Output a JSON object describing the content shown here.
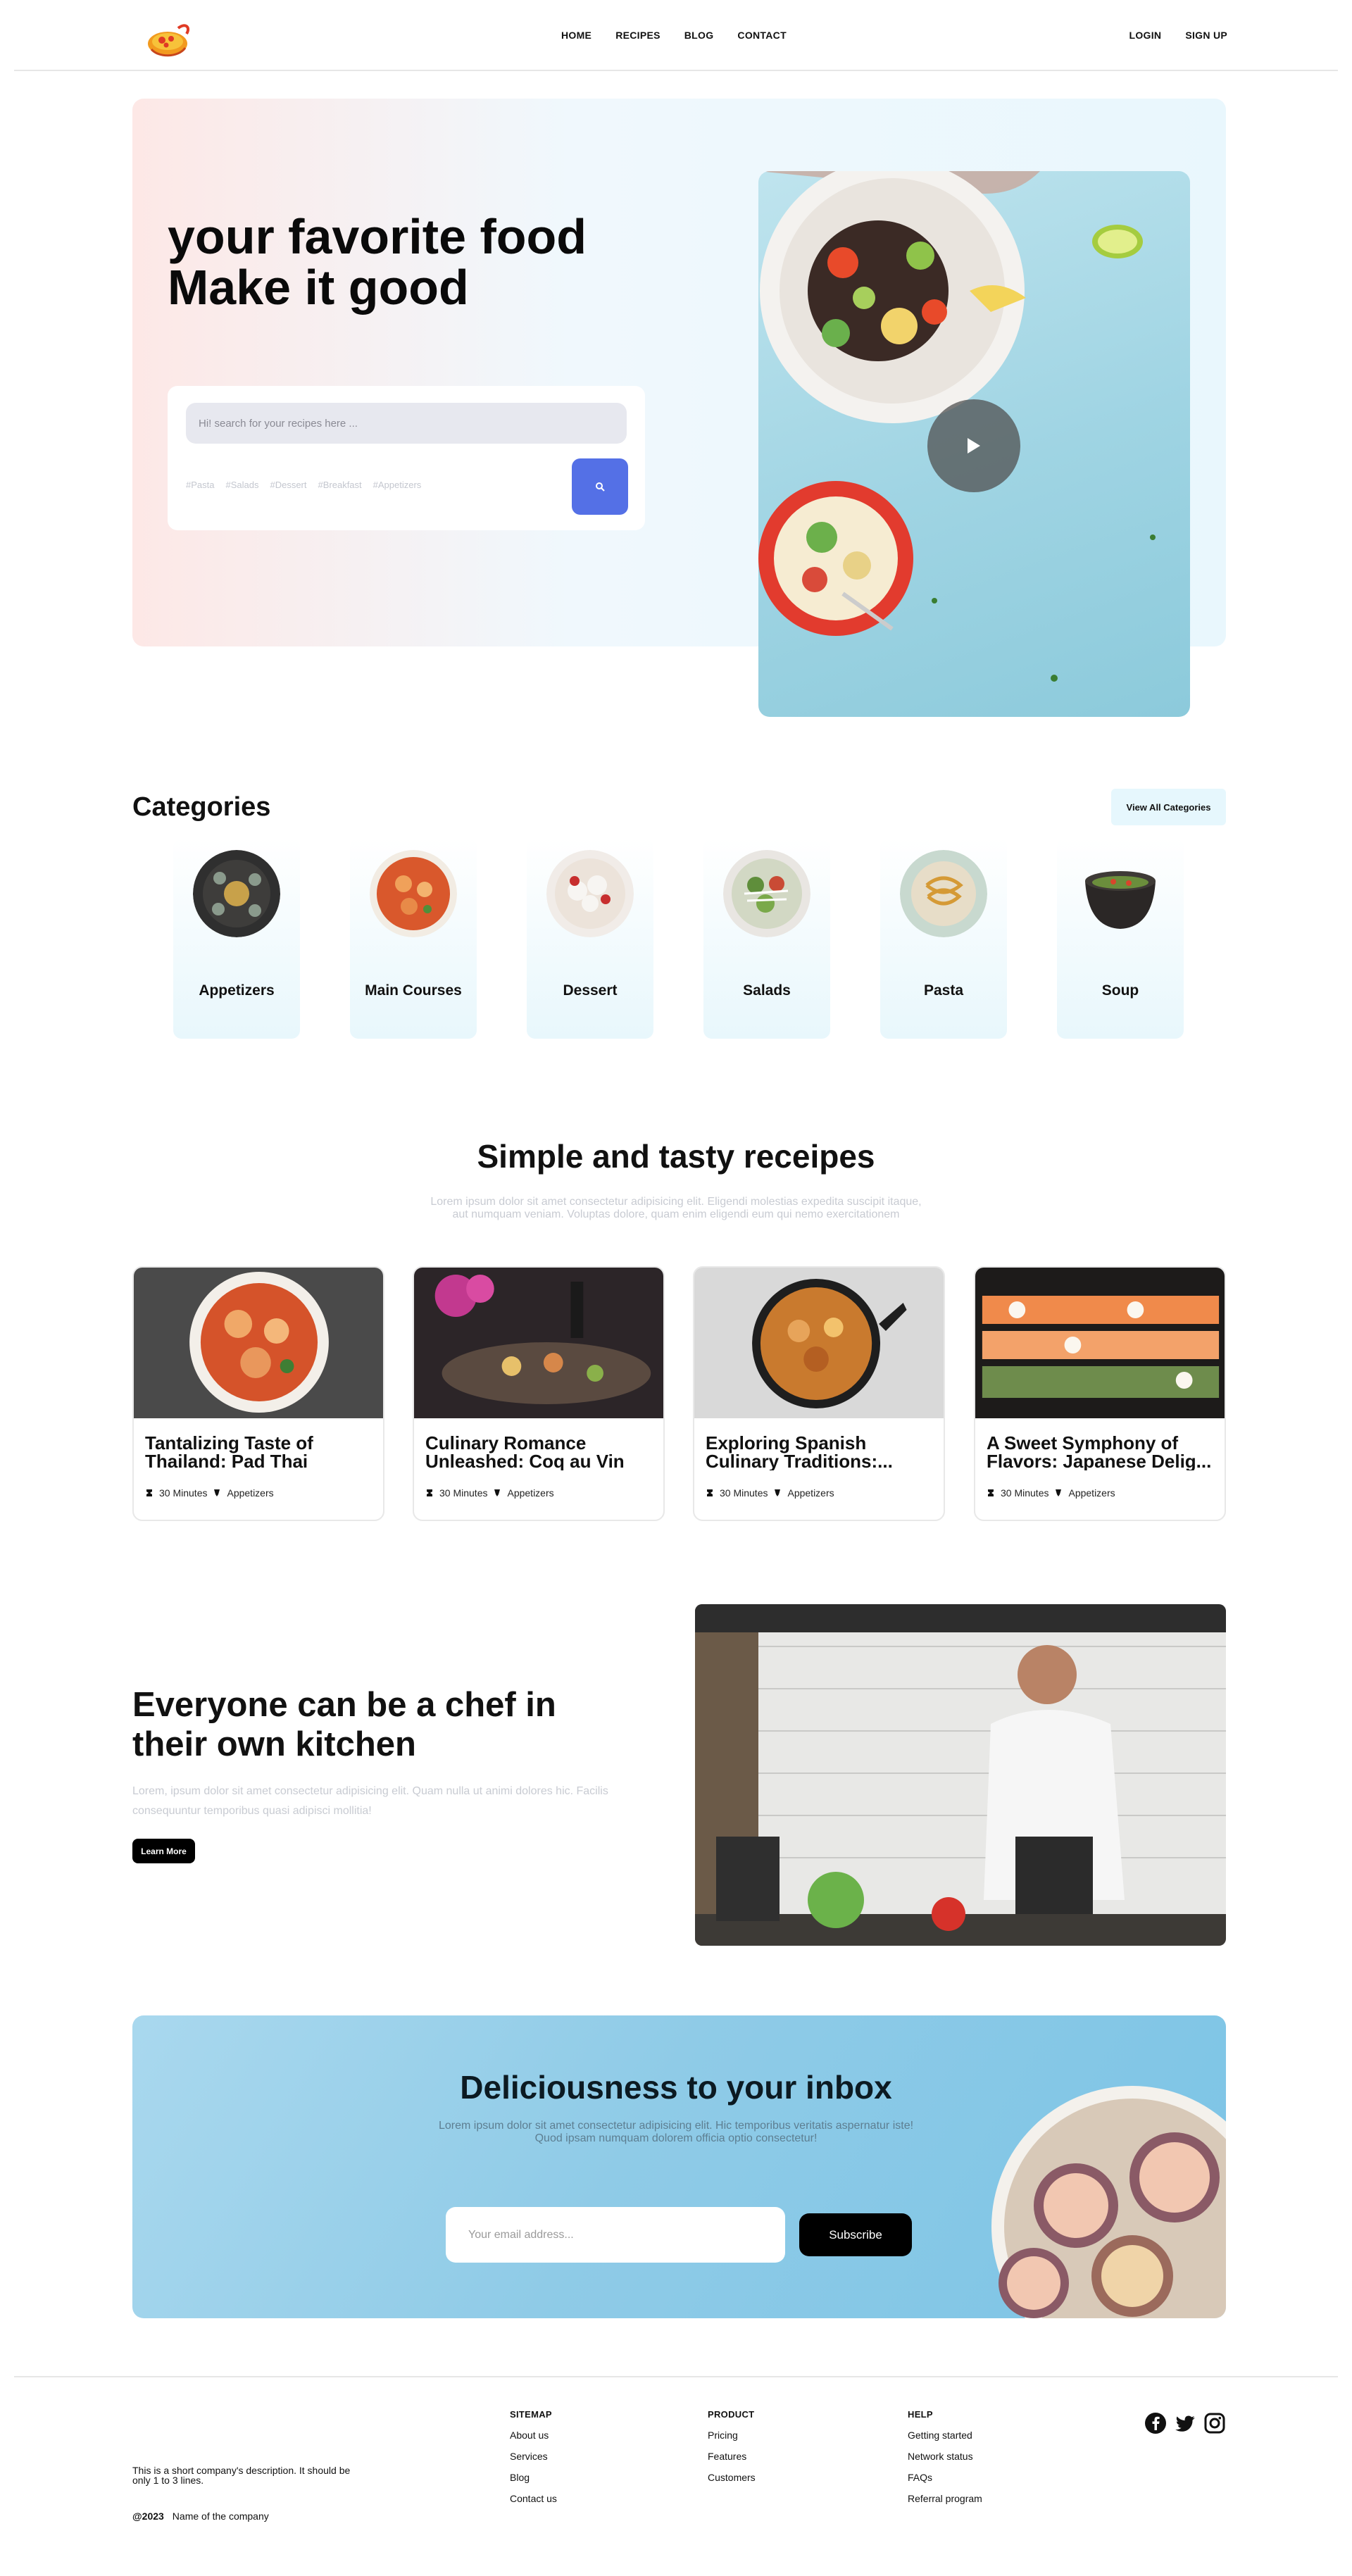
{
  "nav": {
    "links": [
      "HOME",
      "RECIPES",
      "BLOG",
      "CONTACT"
    ],
    "login": "LOGIN",
    "signup": "SIGN UP"
  },
  "hero": {
    "title_line1": "your favorite food",
    "title_line2": "Make it good",
    "search_placeholder": "Hi! search for your recipes here ...",
    "tags": [
      "#Pasta",
      "#Salads",
      "#Dessert",
      "#Breakfast",
      "#Appetizers"
    ]
  },
  "categories": {
    "title": "Categories",
    "view_all": "View All Categories",
    "items": [
      "Appetizers",
      "Main Courses",
      "Dessert",
      "Salads",
      "Pasta",
      "Soup"
    ]
  },
  "recipes": {
    "title": "Simple and tasty receipes",
    "subtitle": "Lorem ipsum dolor sit amet consectetur adipisicing elit. Eligendi molestias expedita suscipit itaque, aut numquam veniam. Voluptas dolore, quam enim eligendi eum qui nemo exercitationem",
    "cards": [
      {
        "name": "Tantalizing Taste of Thailand: Pad Thai",
        "time": "30 Minutes",
        "category": "Appetizers"
      },
      {
        "name": "Culinary Romance Unleashed: Coq au Vin",
        "time": "30 Minutes",
        "category": "Appetizers"
      },
      {
        "name": "Exploring Spanish Culinary Traditions:...",
        "time": "30 Minutes",
        "category": "Appetizers"
      },
      {
        "name": "A Sweet Symphony of Flavors: Japanese Delig...",
        "time": "30 Minutes",
        "category": "Appetizers"
      }
    ]
  },
  "chef": {
    "title": "Everyone can be a chef in their own kitchen",
    "text": "Lorem, ipsum dolor sit amet consectetur adipisicing elit. Quam nulla ut animi dolores hic. Facilis consequuntur temporibus quasi adipisci mollitia!",
    "button": "Learn More"
  },
  "newsletter": {
    "title": "Deliciousness to your inbox",
    "subtitle": "Lorem ipsum dolor sit amet consectetur adipisicing elit. Hic temporibus veritatis aspernatur iste! Quod ipsam numquam dolorem officia optio consectetur!",
    "email_placeholder": "Your email address...",
    "button": "Subscribe"
  },
  "footer": {
    "description": "This is a short company's description. It should be only 1 to 3 lines.",
    "copyright": "@2023",
    "company": "Name of the company",
    "sitemap": {
      "title": "SITEMAP",
      "links": [
        "About us",
        "Services",
        "Blog",
        "Contact us"
      ]
    },
    "product": {
      "title": "PRODUCT",
      "links": [
        "Pricing",
        "Features",
        "Customers"
      ]
    },
    "help": {
      "title": "HELP",
      "links": [
        "Getting started",
        "Network status",
        "FAQs",
        "Referral program"
      ]
    },
    "socials": [
      "facebook-icon",
      "twitter-icon",
      "instagram-icon"
    ]
  },
  "colors": {
    "accent": "#5470e6",
    "dark": "#000000",
    "hero_pink": "#fde8e6",
    "hero_blue": "#e9f7fd",
    "newsletter_blue": "#8fcbe7"
  }
}
